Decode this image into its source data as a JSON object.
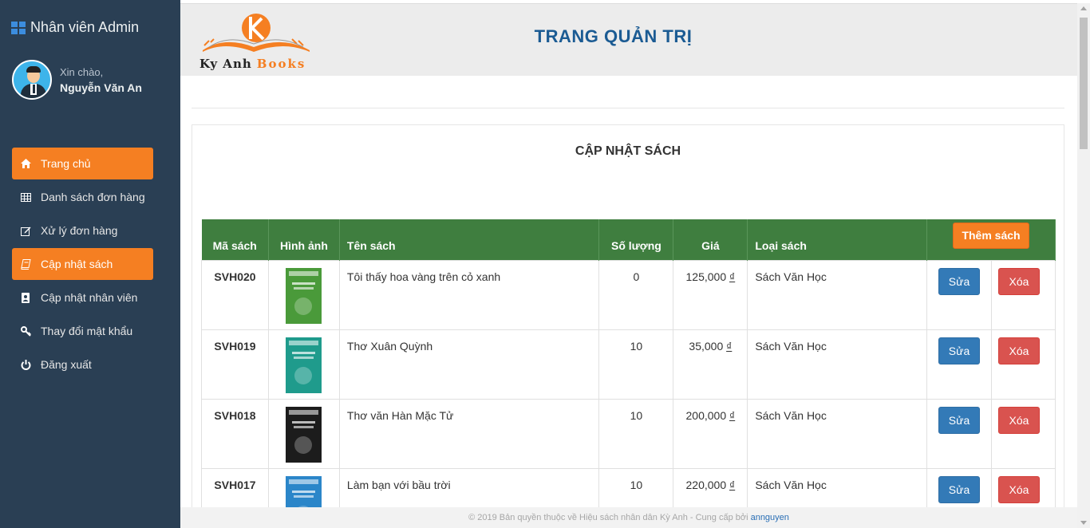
{
  "sidebar": {
    "brand": "Nhân viên Admin",
    "greeting": "Xin chào,",
    "username": "Nguyễn Văn An",
    "menu": [
      {
        "label": "Trang chủ",
        "icon": "home-icon",
        "active": true
      },
      {
        "label": "Danh sách đơn hàng",
        "icon": "table-icon",
        "active": false
      },
      {
        "label": "Xử lý đơn hàng",
        "icon": "edit-icon",
        "active": false
      },
      {
        "label": "Cập nhật sách",
        "icon": "book-icon",
        "active": true
      },
      {
        "label": "Cập nhật nhân viên",
        "icon": "contact-book-icon",
        "active": false
      },
      {
        "label": "Thay đổi mật khẩu",
        "icon": "key-icon",
        "active": false
      },
      {
        "label": "Đăng xuất",
        "icon": "power-icon",
        "active": false
      }
    ]
  },
  "header": {
    "logo_main": "Ky Anh",
    "logo_accent": "Books",
    "title": "TRANG QUẢN TRỊ"
  },
  "panel": {
    "title": "CẬP NHẬT SÁCH",
    "add_button": "Thêm sách",
    "columns": [
      "Mã sách",
      "Hình ảnh",
      "Tên sách",
      "Số lượng",
      "Giá",
      "Loại sách"
    ],
    "edit_label": "Sửa",
    "delete_label": "Xóa",
    "rows": [
      {
        "code": "SVH020",
        "name": "Tôi thấy hoa vàng trên cỏ xanh",
        "qty": "0",
        "price": "125,000",
        "currency": "₫",
        "category": "Sách Văn Học",
        "cover_color": "#4a9a3a"
      },
      {
        "code": "SVH019",
        "name": "Thơ Xuân Quỳnh",
        "qty": "10",
        "price": "35,000",
        "currency": "₫",
        "category": "Sách Văn Học",
        "cover_color": "#1f9b8c"
      },
      {
        "code": "SVH018",
        "name": "Thơ văn Hàn Mặc Tử",
        "qty": "10",
        "price": "200,000",
        "currency": "₫",
        "category": "Sách Văn Học",
        "cover_color": "#1c1c1c"
      },
      {
        "code": "SVH017",
        "name": "Làm bạn với bầu trời",
        "qty": "10",
        "price": "220,000",
        "currency": "₫",
        "category": "Sách Văn Học",
        "cover_color": "#2b86c9"
      }
    ]
  },
  "footer": {
    "text": "© 2019 Bản quyền thuộc về Hiệu sách nhân dân Kỳ Anh - Cung cấp bởi ",
    "link": "annguyen"
  },
  "colors": {
    "sidebar_bg": "#2a3f54",
    "accent_orange": "#f57f22",
    "table_header_green": "#3f7e3f",
    "edit_blue": "#337ab7",
    "delete_red": "#d9534f",
    "title_blue": "#1b5b93"
  }
}
